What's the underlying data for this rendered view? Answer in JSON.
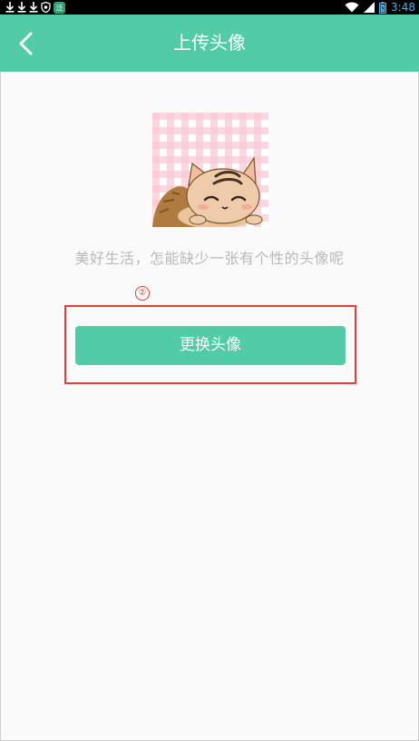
{
  "status_bar": {
    "time": "3:48",
    "icons": [
      "download-icon",
      "download-icon",
      "download-icon",
      "shield-icon",
      "app-badge-icon",
      "wifi-icon",
      "signal-icon",
      "battery-icon"
    ]
  },
  "app_bar": {
    "title": "上传头像",
    "back_icon": "chevron-left-icon",
    "color": "#52cca8"
  },
  "main": {
    "tagline": "美好生活，怎能缺少一张有个性的头像呢",
    "step_marker": "②",
    "change_button_label": "更换头像",
    "highlight_color": "#e53c3c"
  }
}
